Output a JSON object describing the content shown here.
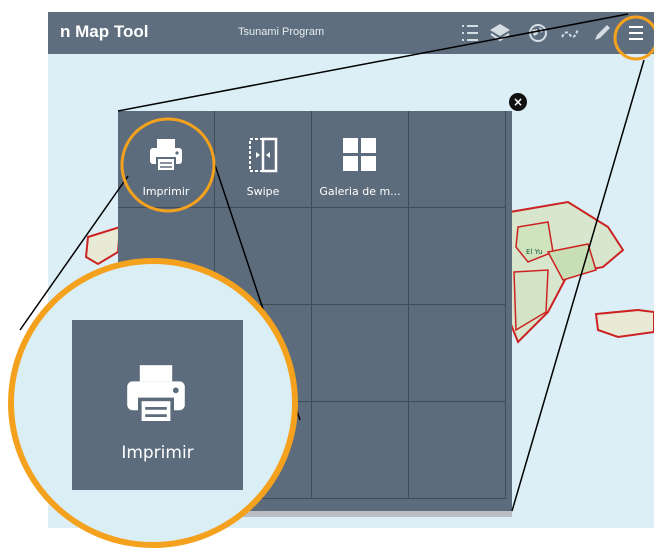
{
  "header": {
    "title": "n Map Tool",
    "subtitle": "Tsunami Program",
    "icons": [
      "legend-icon",
      "layers-icon",
      "basemap-icon",
      "measure-icon",
      "draw-icon",
      "menu-icon"
    ]
  },
  "widget_panel": {
    "close_symbol": "×",
    "tiles": [
      {
        "label": "Imprimir",
        "icon": "printer-icon"
      },
      {
        "label": "Swipe",
        "icon": "swipe-icon"
      },
      {
        "label": "Galeria de m...",
        "icon": "basemap-gallery-icon"
      }
    ]
  },
  "zoom_callout": {
    "label": "Imprimir",
    "icon": "printer-icon"
  },
  "colors": {
    "header": "#5f6e7e",
    "panel": "#5d6c7c",
    "highlight": "#f4a11d",
    "map_water": "#dbeef6",
    "boundary": "#cc2222"
  }
}
